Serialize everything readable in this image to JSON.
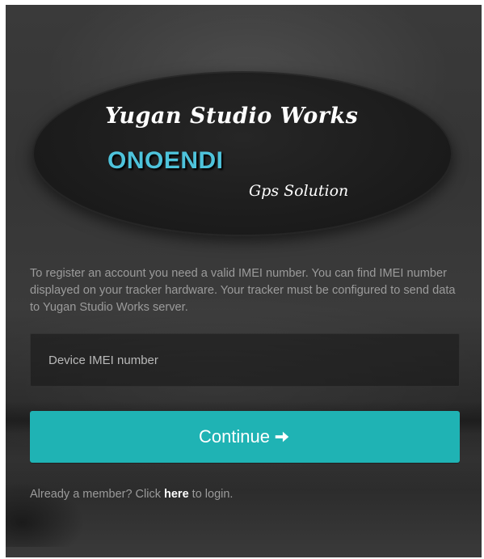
{
  "logo": {
    "title": "Yugan Studio Works",
    "brand": "ONOENDI",
    "subtitle": "Gps Solution",
    "brand_color": "#4ec3db"
  },
  "register": {
    "intro_text": "To register an account you need a valid IMEI number. You can find IMEI number displayed on your tracker hardware. Your tracker must be configured to send data to Yugan Studio Works server.",
    "imei_value": "",
    "imei_placeholder": "Device IMEI number",
    "continue_label": "Continue",
    "continue_icon": "arrow-right-icon",
    "button_color": "#1fb3b4"
  },
  "footer": {
    "prefix": "Already a member? Click ",
    "link_label": "here",
    "suffix": " to login."
  }
}
